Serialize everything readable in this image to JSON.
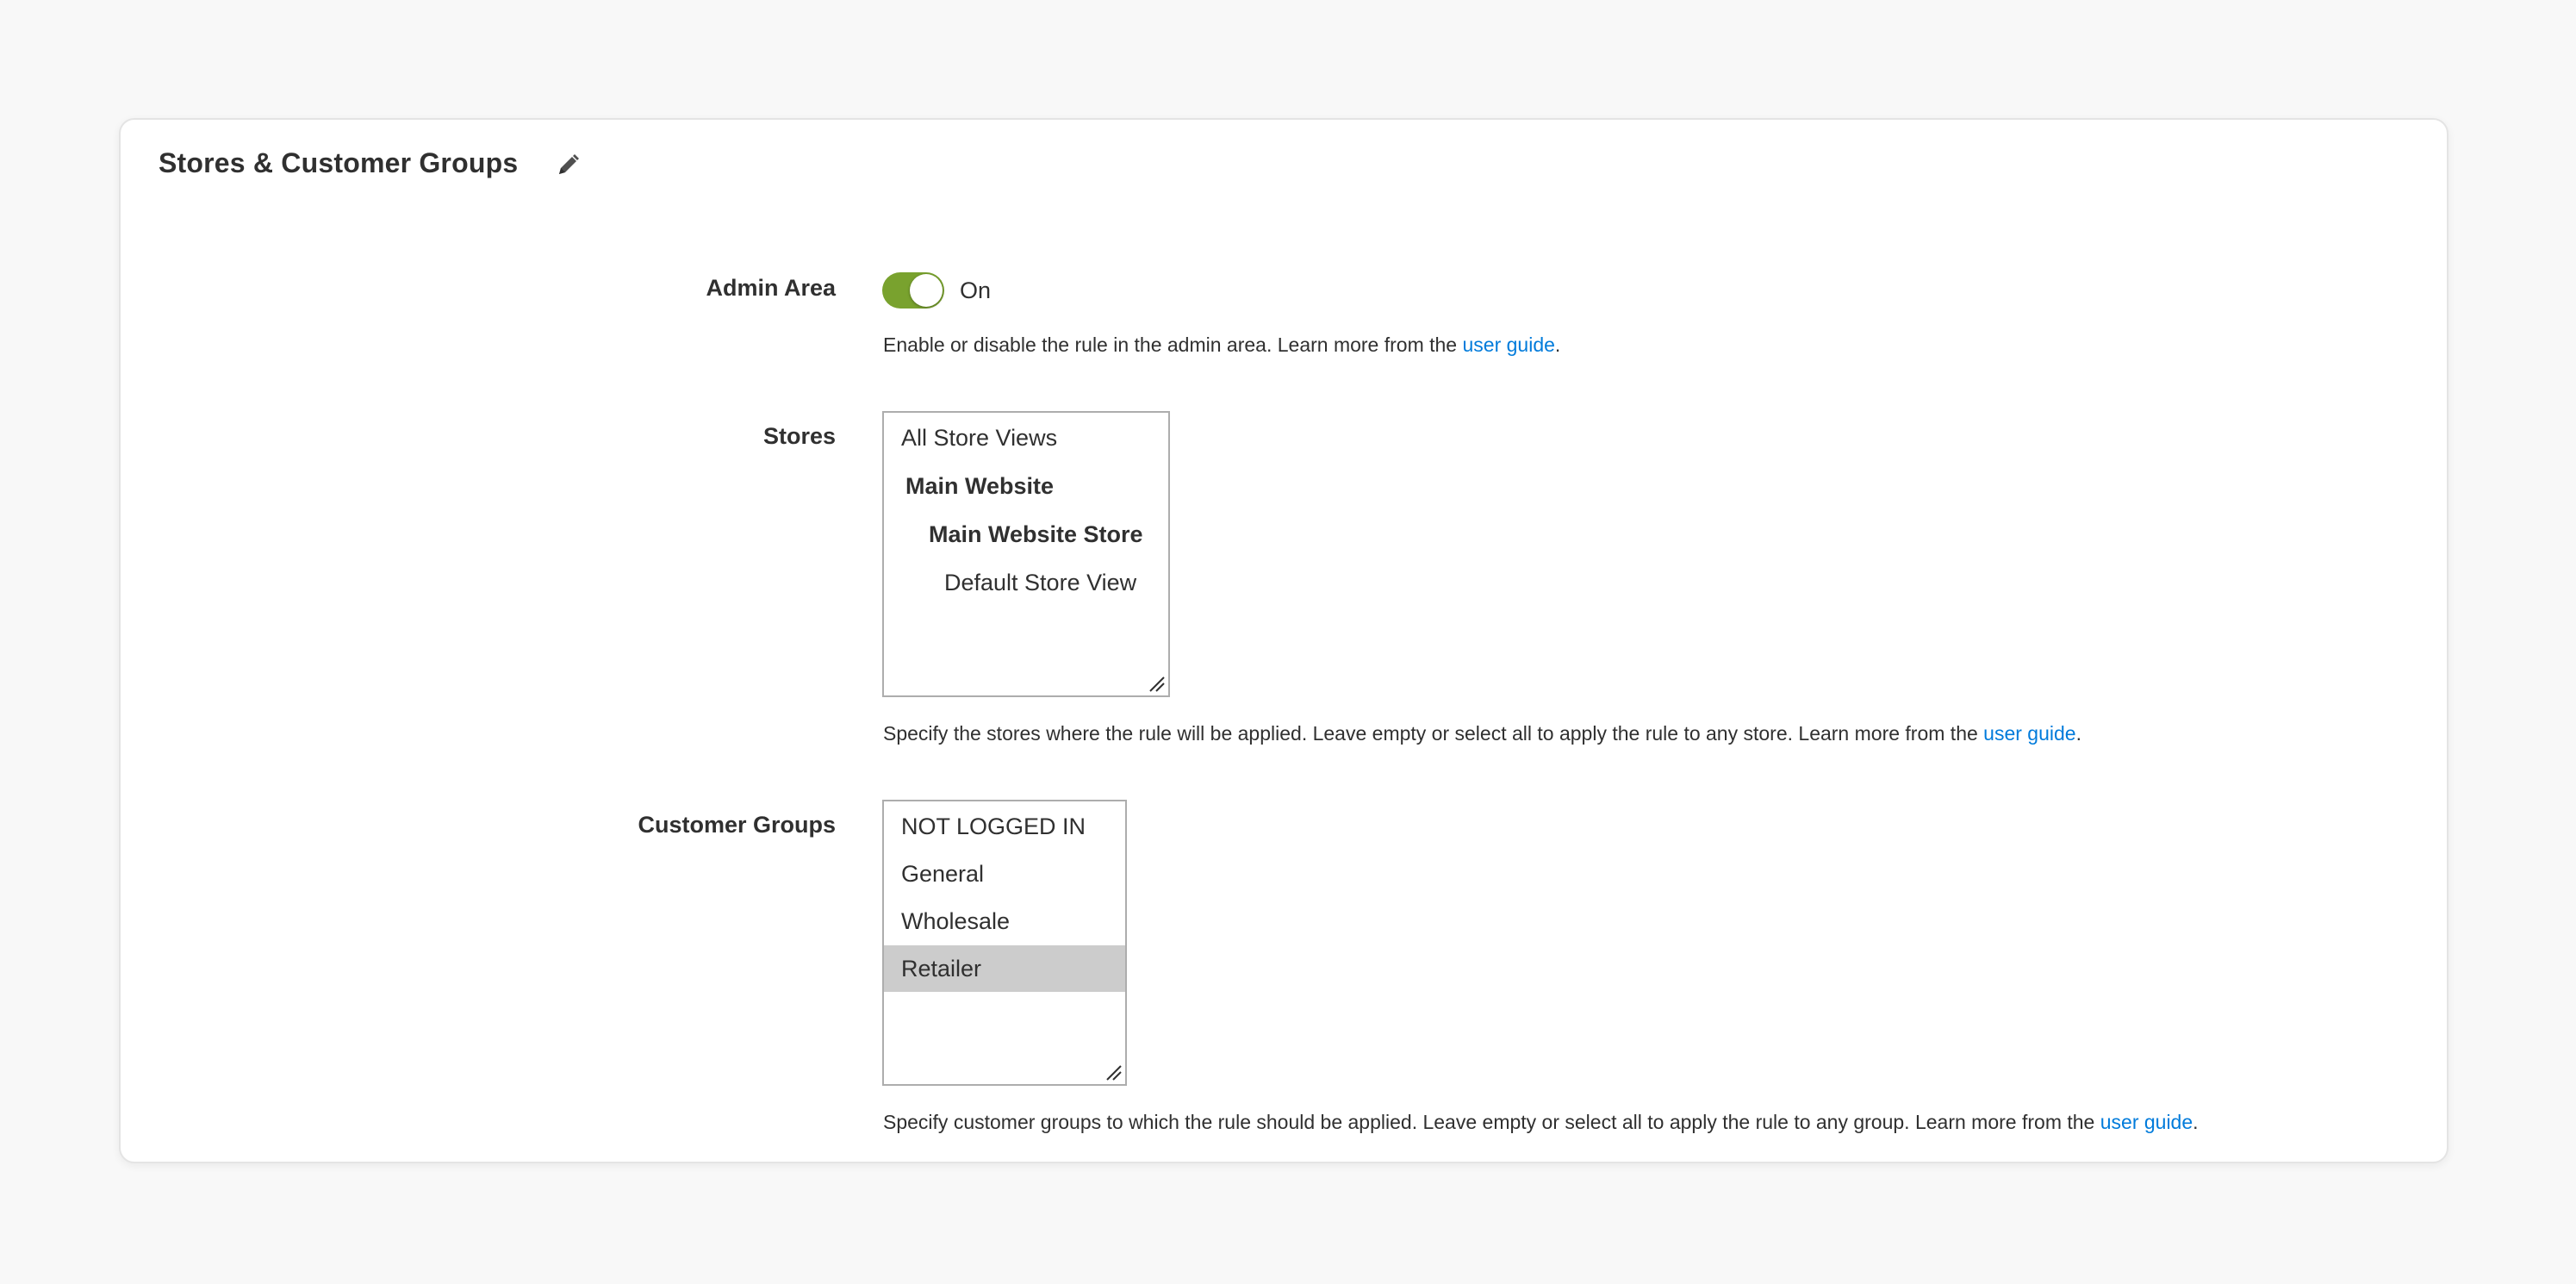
{
  "section": {
    "title": "Stores & Customer Groups",
    "edit_icon": "pencil-icon"
  },
  "admin_area": {
    "label": "Admin Area",
    "toggle_state": "On",
    "toggle_color": "#79a22e",
    "note_text": "Enable or disable the rule in the admin area. Learn more from the ",
    "note_link": "user guide",
    "note_end": "."
  },
  "stores": {
    "label": "Stores",
    "options": [
      {
        "label": "All Store Views",
        "bold": false,
        "level": 0
      },
      {
        "label": "Main Website",
        "bold": true,
        "level": 0
      },
      {
        "label": "Main Website Store",
        "bold": true,
        "level": 1
      },
      {
        "label": "Default Store View",
        "bold": false,
        "level": 2
      }
    ],
    "note_text": "Specify the stores where the rule will be applied. Leave empty or select all to apply the rule to any store. Learn more from the ",
    "note_link": "user guide",
    "note_end": "."
  },
  "customer_groups": {
    "label": "Customer Groups",
    "options": [
      {
        "label": "NOT LOGGED IN",
        "selected": false
      },
      {
        "label": "General",
        "selected": false
      },
      {
        "label": "Wholesale",
        "selected": false
      },
      {
        "label": "Retailer",
        "selected": true
      }
    ],
    "note_text": "Specify customer groups to which the rule should be applied. Leave empty or select all to apply the rule to any group. Learn more from the ",
    "note_link": "user guide",
    "note_end": "."
  },
  "colors": {
    "link": "#007bdb",
    "selected_option_bg": "#cccccc"
  }
}
